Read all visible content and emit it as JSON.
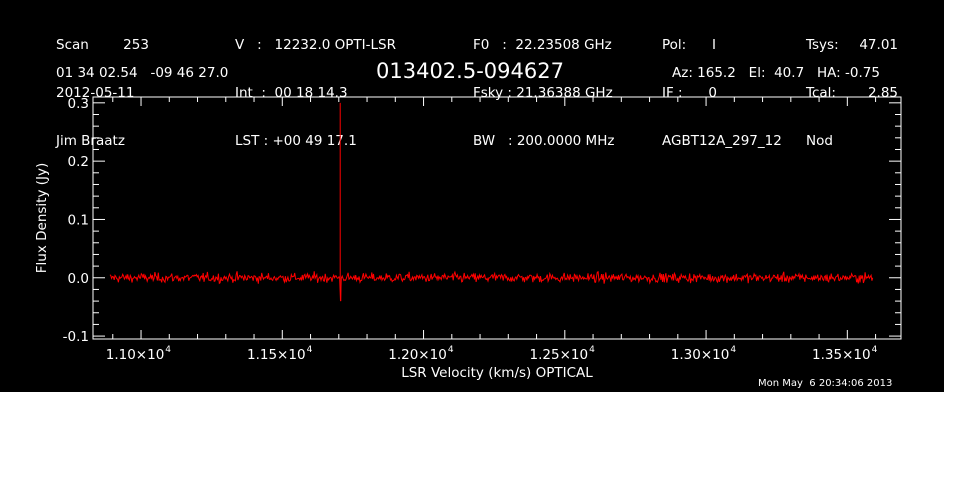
{
  "header": {
    "col1": [
      "Scan        253",
      "2012-05-11",
      "Jim Braatz"
    ],
    "col2": [
      "V   :   12232.0 OPTI-LSR",
      "Int  :  00 18 14.3",
      "LST : +00 49 17.1"
    ],
    "col3": [
      "F0   :  22.23508 GHz",
      "Fsky : 21.36388 GHz",
      "BW   : 200.0000 MHz"
    ],
    "col4": [
      "Pol:      I",
      "IF :      0",
      "AGBT12A_297_12"
    ],
    "col5": [
      "Tsys:",
      "Tcal:",
      "Nod"
    ],
    "col5_values": [
      "47.01",
      "2.85",
      ""
    ],
    "coords": "01 34 02.54   -09 46 27.0",
    "source": "013402.5-094627",
    "pointing": "Az: 165.2   El:  40.7   HA: -0.75",
    "timestamp": "Mon May  6 20:34:06 2013"
  },
  "chart_data": {
    "type": "line",
    "xlabel": "LSR Velocity (km/s) OPTICAL",
    "ylabel": "Flux Density (Jy)",
    "xlim": [
      10830,
      13690
    ],
    "ylim": [
      -0.105,
      0.31
    ],
    "x_ticks": [
      11000,
      11500,
      12000,
      12500,
      13000,
      13500
    ],
    "x_tick_labels": [
      "1.10×10",
      "1.15×10",
      "1.20×10",
      "1.25×10",
      "1.30×10",
      "1.35×10"
    ],
    "x_tick_exponent": "4",
    "y_ticks": [
      -0.1,
      0.0,
      0.1,
      0.2,
      0.3
    ],
    "y_tick_labels": [
      "-0.1",
      "0.0",
      "0.1",
      "0.2",
      "0.3"
    ],
    "grid": false,
    "series": [
      {
        "color": "#ff0000",
        "x_range": [
          10890,
          13590
        ],
        "baseline": 0.0,
        "noise_rms": 0.004,
        "features": [
          {
            "x": 11705,
            "peak": 0.3
          },
          {
            "x": 11707,
            "peak": -0.04
          }
        ]
      }
    ]
  },
  "colors": {
    "background": "#000000",
    "axes": "#ffffff",
    "text": "#ffffff",
    "data": "#ff0000"
  }
}
